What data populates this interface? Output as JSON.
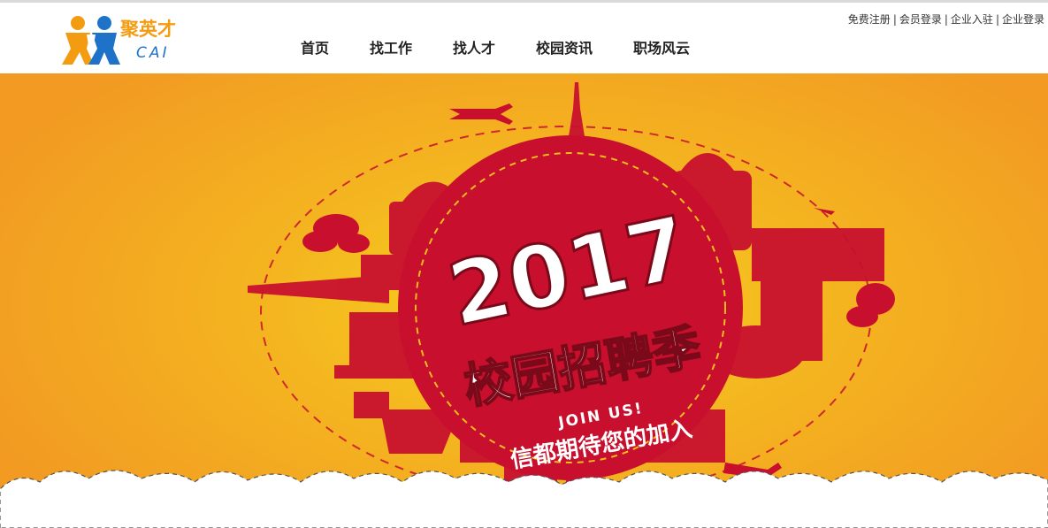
{
  "brand": {
    "name": "聚英才",
    "sub": "CAI"
  },
  "nav": {
    "items": [
      {
        "label": "首页"
      },
      {
        "label": "找工作"
      },
      {
        "label": "找人才"
      },
      {
        "label": "校园资讯"
      },
      {
        "label": "职场风云"
      }
    ]
  },
  "toplinks": {
    "items": [
      {
        "label": "免费注册"
      },
      {
        "label": "会员登录"
      },
      {
        "label": "企业入驻"
      },
      {
        "label": "企业登录"
      }
    ],
    "separator": "|"
  },
  "banner": {
    "year": "2017",
    "headline": "校园招聘季",
    "join": "JOIN US!",
    "tagline": "信都期待您的加入",
    "colors": {
      "red": "#c8102e",
      "orange": "#f29a22",
      "yellow": "#f7d21c"
    }
  }
}
